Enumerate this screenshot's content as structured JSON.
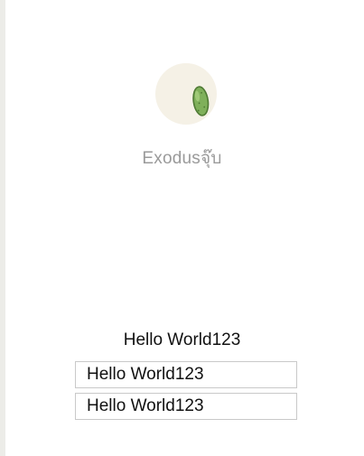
{
  "profile": {
    "username": "Exodusจุ๊บ",
    "avatar_icon": "pickle-icon",
    "avatar_bg": "#f5f1e6"
  },
  "content": {
    "heading": "Hello World123",
    "field_1_value": "Hello World123",
    "field_2_value": "Hello World123"
  }
}
